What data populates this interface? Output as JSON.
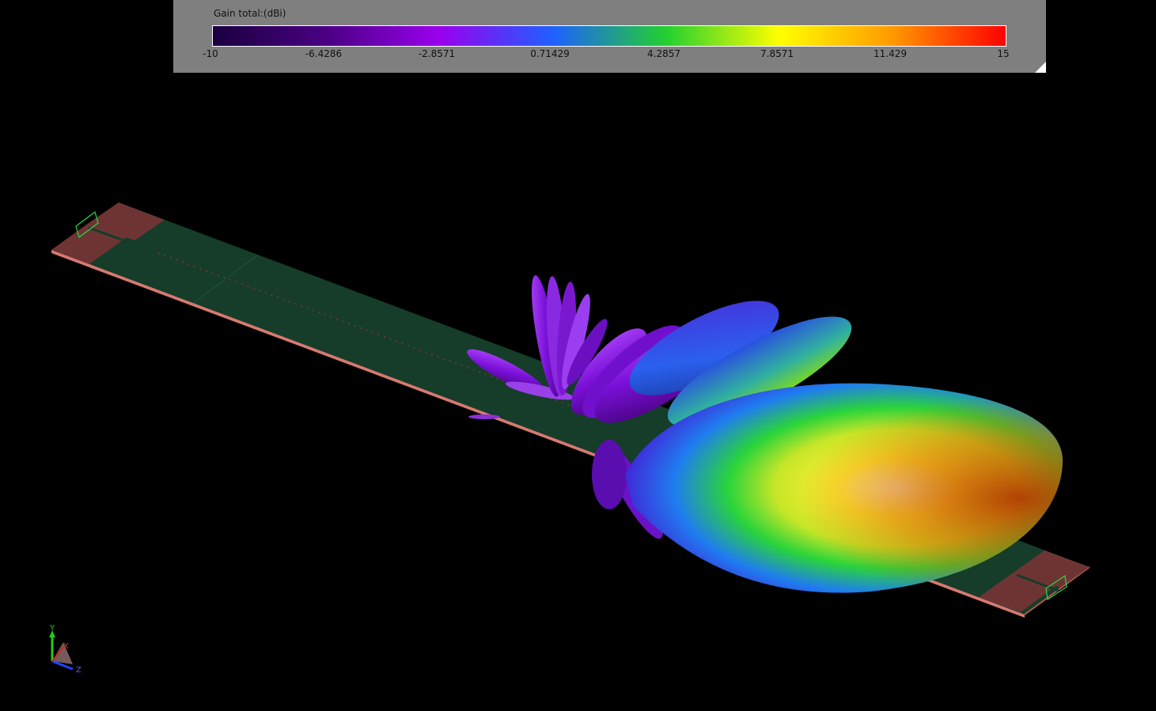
{
  "legend": {
    "title": "Gain total:(dBi)",
    "ticks": [
      "-10",
      "-6.4286",
      "-2.8571",
      "0.71429",
      "4.2857",
      "7.8571",
      "11.429",
      "15"
    ],
    "colors": [
      "#1a0040",
      "#4a0082",
      "#9a00ee",
      "#1f60ff",
      "#22d030",
      "#ffff00",
      "#ff9900",
      "#ff0000"
    ]
  },
  "axes": {
    "y": "Y",
    "x": "X",
    "z": "Z"
  },
  "colors": {
    "background": "#000000",
    "board": "#153d29",
    "port_pad": "#6e3434",
    "panel": "#7f7f7f"
  }
}
